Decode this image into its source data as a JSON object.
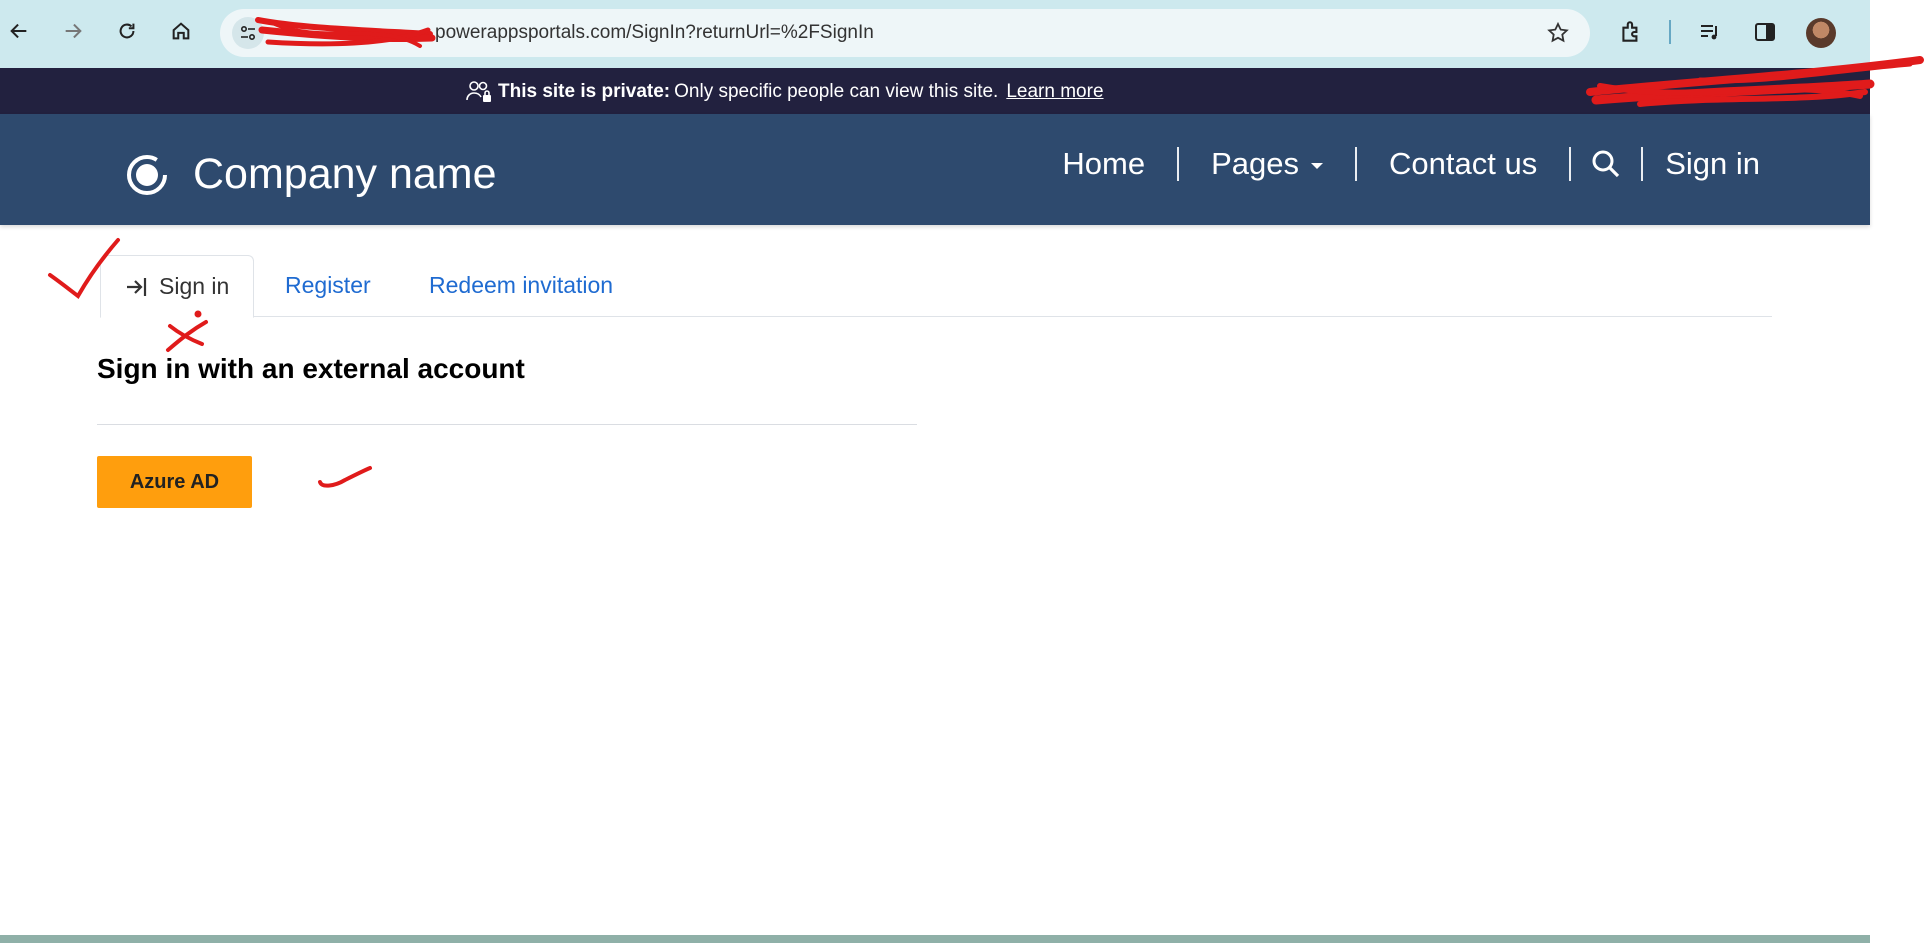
{
  "browser": {
    "url": "powerappsportals.com/SignIn?returnUrl=%2FSignIn",
    "icons": [
      "back-arrow-icon",
      "forward-arrow-icon",
      "reload-icon",
      "home-icon",
      "site-info-icon",
      "bookmark-star-icon",
      "extensions-icon",
      "media-control-icon",
      "side-panel-icon",
      "profile-avatar"
    ]
  },
  "banner": {
    "bold_text": "This site is private:",
    "text": "Only specific people can view this site.",
    "link": "Learn more"
  },
  "header": {
    "brand_name": "Company name",
    "nav": {
      "home": "Home",
      "pages": "Pages",
      "contact": "Contact us",
      "sign_in": "Sign in"
    }
  },
  "tabs": {
    "sign_in": "Sign in",
    "register": "Register",
    "redeem": "Redeem invitation"
  },
  "main": {
    "title": "Sign in with an external account",
    "azure_button": "Azure AD"
  },
  "colors": {
    "browser_bar": "#cde9ee",
    "banner": "#22213f",
    "header": "#2e4a6e",
    "link": "#1f6bd1",
    "azure_button": "#ff9e0d",
    "annotation": "#e01b1b"
  }
}
